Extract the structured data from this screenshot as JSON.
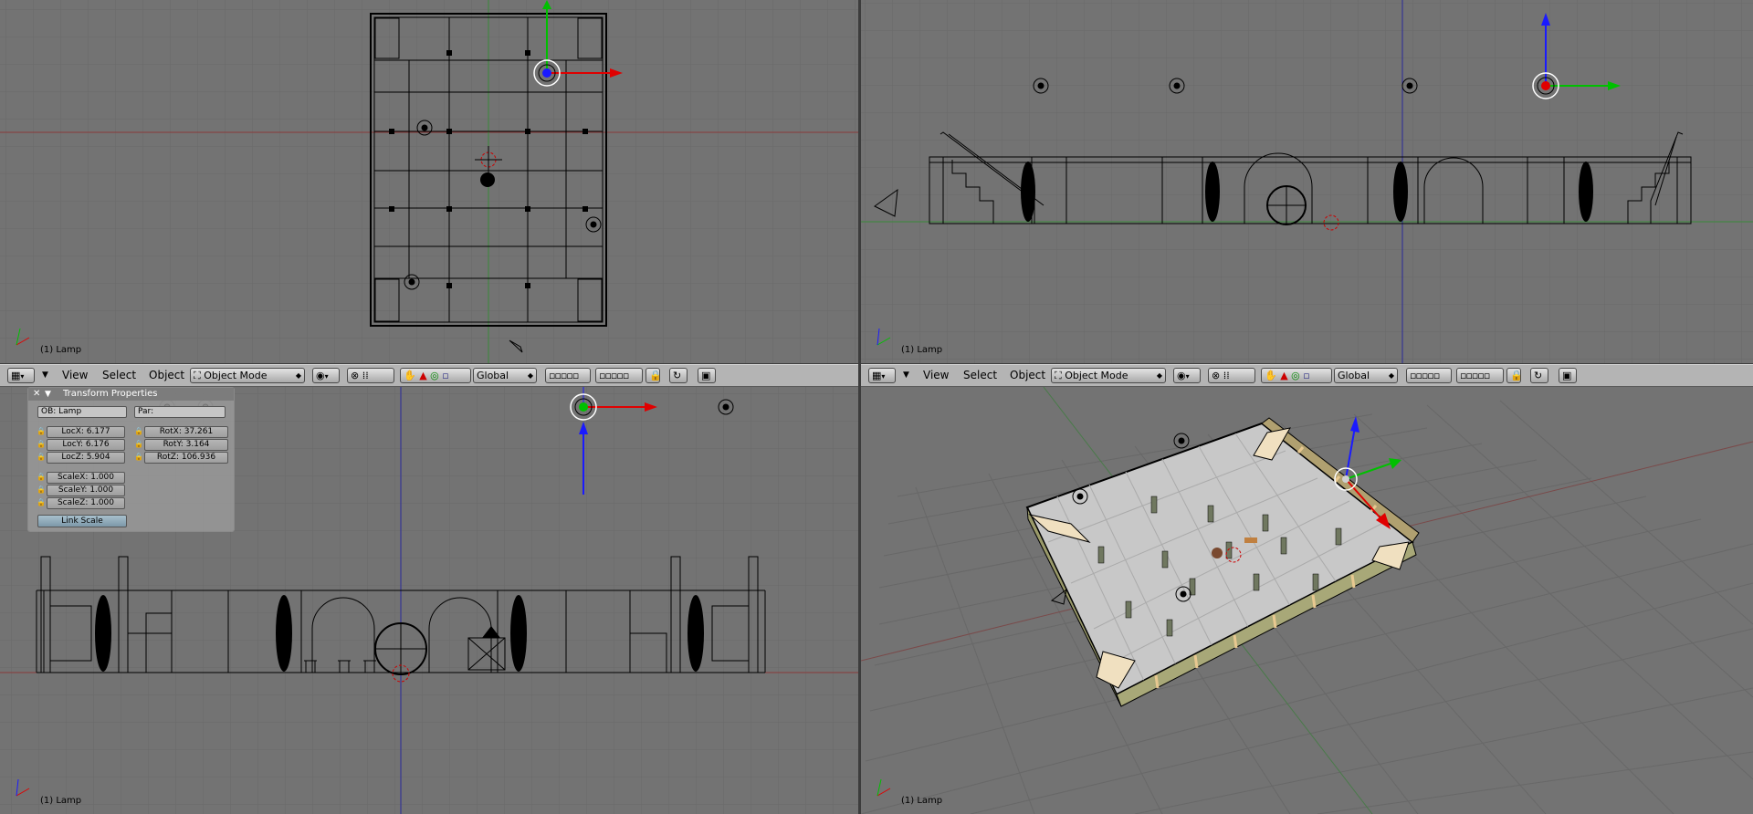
{
  "viewports": {
    "top_left": {
      "status": "(1) Lamp"
    },
    "top_right": {
      "status": "(1) Lamp"
    },
    "bottom_left": {
      "status": "(1) Lamp"
    },
    "bottom_right": {
      "status": "(1) Lamp"
    }
  },
  "header_left": {
    "menu_view": "View",
    "menu_select": "Select",
    "menu_object": "Object",
    "mode": "Object Mode",
    "orientation": "Global"
  },
  "header_right": {
    "menu_view": "View",
    "menu_select": "Select",
    "menu_object": "Object",
    "mode": "Object Mode",
    "orientation": "Global"
  },
  "transform_panel": {
    "title": "Transform Properties",
    "close_glyph": "✕",
    "collapse_glyph": "▼",
    "ob": "OB: Lamp",
    "par": "Par:",
    "locx": "LocX: 6.177",
    "locy": "LocY: 6.176",
    "locz": "LocZ: 5.904",
    "rotx": "RotX: 37.261",
    "roty": "RotY: 3.164",
    "rotz": "RotZ: 106.936",
    "scalex": "ScaleX: 1.000",
    "scaley": "ScaleY: 1.000",
    "scalez": "ScaleZ: 1.000",
    "link_scale": "Link Scale"
  },
  "colors": {
    "viewport_bg": "#737373",
    "header_bg": "#b4b4b4",
    "axis_x": "#e00000",
    "axis_y": "#00c000",
    "axis_z": "#1a1aff",
    "wire": "#000000"
  },
  "icons": [
    "window-type-icon",
    "shading-icon",
    "rotation-pivot-icon",
    "manipulator-icon",
    "layer-icon",
    "lock-icon",
    "render-icon"
  ]
}
